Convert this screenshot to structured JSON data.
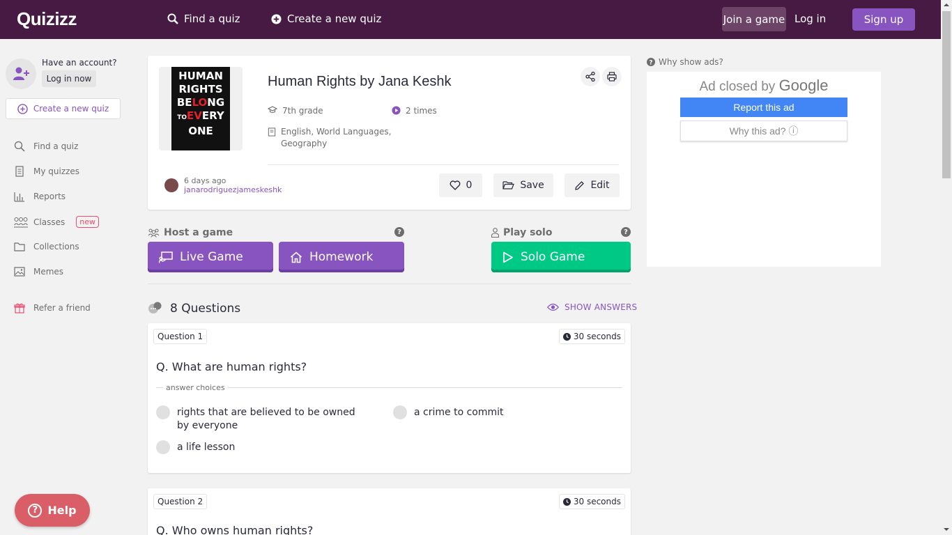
{
  "header": {
    "logo": "Quizizz",
    "find_quiz": "Find a quiz",
    "create_quiz": "Create a new quiz",
    "join_game": "Join a game",
    "log_in": "Log in",
    "sign_up": "Sign up"
  },
  "sidebar": {
    "have_account": "Have an account?",
    "log_in_now": "Log in now",
    "create_quiz": "Create a new quiz",
    "items": [
      {
        "label": "Find a quiz",
        "icon": "search-icon"
      },
      {
        "label": "My quizzes",
        "icon": "document-icon"
      },
      {
        "label": "Reports",
        "icon": "bar-chart-icon"
      },
      {
        "label": "Classes",
        "icon": "classes-icon",
        "badge": "new"
      },
      {
        "label": "Collections",
        "icon": "folder-icon"
      },
      {
        "label": "Memes",
        "icon": "image-icon"
      },
      {
        "label": "Refer a friend",
        "icon": "gift-icon"
      }
    ]
  },
  "quiz": {
    "cover_text": [
      "HUMAN",
      "RIGHTS",
      "BE",
      "LO",
      "NG",
      "TO",
      "EV",
      "ERY",
      "ONE"
    ],
    "title": "Human Rights by Jana Keshk",
    "grade": "7th grade",
    "plays": "2 times",
    "subjects": "English, World Languages, Geography",
    "time_ago": "6 days ago",
    "author": "janarodriguezjameskeshk",
    "likes": "0",
    "save": "Save",
    "edit": "Edit"
  },
  "host": {
    "label": "Host a game",
    "live_game": "Live Game",
    "homework": "Homework"
  },
  "solo": {
    "label": "Play solo",
    "solo_game": "Solo Game"
  },
  "questions_header": {
    "count_label": "8 Questions",
    "show_answers": "SHOW ANSWERS"
  },
  "questions": [
    {
      "tag": "Question 1",
      "time": "30 seconds",
      "text": "Q. What are human rights?",
      "choices_label": "answer choices",
      "choices": [
        "rights that are believed to be owned by everyone",
        "a crime to commit",
        "a life lesson"
      ]
    },
    {
      "tag": "Question 2",
      "time": "30 seconds",
      "text": "Q. Who owns human rights?"
    }
  ],
  "ad": {
    "why_show_ads": "Why show ads?",
    "closed_by": "Ad closed by",
    "google": "Google",
    "report": "Report this ad",
    "why_this": "Why this ad? ⓘ"
  },
  "help": {
    "label": "Help"
  },
  "colors": {
    "header_bg": "#461a42",
    "accent_purple": "#8854c0",
    "solo_green": "#00c985",
    "help_red": "#d95e68"
  }
}
